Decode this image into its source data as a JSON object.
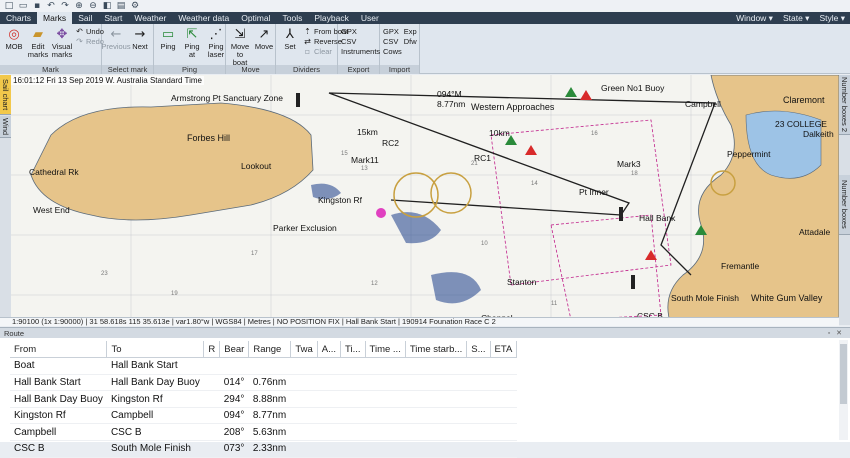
{
  "qat_icons": [
    "new-icon",
    "open-icon",
    "save-icon",
    "undo-icon",
    "redo-icon",
    "zoom-in-icon",
    "zoom-out-icon",
    "chart-icon",
    "print-icon",
    "settings-icon"
  ],
  "tabs": [
    "Charts",
    "Marks",
    "Sail",
    "Start",
    "Weather",
    "Weather data",
    "Optimal",
    "Tools",
    "Playback",
    "User"
  ],
  "active_tab": "Marks",
  "window_menus": [
    "Window",
    "State",
    "Style"
  ],
  "ribbon": {
    "mark": {
      "label": "Mark",
      "mob": "MOB",
      "edit": "Edit marks",
      "visual": "Visual marks",
      "undo": "Undo",
      "redo": "Redo"
    },
    "select_mark": {
      "label": "Select mark",
      "previous": "Previous",
      "next": "Next"
    },
    "ping": {
      "label": "Ping",
      "ping": "Ping",
      "ping_at": "Ping at",
      "ping_laser": "Ping laser"
    },
    "move": {
      "label": "Move",
      "move_to_boat": "Move to boat",
      "move": "Move"
    },
    "dividers": {
      "label": "Dividers",
      "set": "Set",
      "from_boat": "From boat",
      "reverse": "Reverse",
      "clear": "Clear"
    },
    "export": {
      "label": "Export",
      "gpx": "GPX",
      "csv": "CSV",
      "instruments": "Instruments"
    },
    "import": {
      "label": "Import",
      "gpx": "GPX",
      "csv": "CSV",
      "cows": "Cows",
      "exp": "Exp",
      "dfw": "Dfw"
    }
  },
  "side_tabs_left": [
    "Sail chart",
    "Wind"
  ],
  "side_tabs_right": [
    "Number boxes 2",
    "Number boxes"
  ],
  "chart_datetime": "16:01:12 Fri 13 Sep 2019 W. Australia Standard Time",
  "map_labels": {
    "armstrong": "Armstrong Pt Sanctuary Zone",
    "forbes": "Forbes Hill",
    "western_approaches": "Western Approaches",
    "rc2": "RC2",
    "rc1": "RC1",
    "green_no1": "Green No1 Buoy",
    "campbell": "Campbell",
    "claremont": "Claremont",
    "college": "23 COLLEGE",
    "dalkeith": "Dalkeith",
    "peppermint": "Peppermint",
    "attadale": "Attadale",
    "fremantle": "Fremantle",
    "white_gum": "White Gum Valley",
    "hall_bank": "Hall Bank",
    "stanton": "Stanton",
    "south_mole": "South Mole Finish",
    "csc_b": "CSC B",
    "channel": "Channel",
    "west_end": "West End",
    "cathedral": "Cathedral Rk",
    "parker": "Parker Exclusion",
    "lookout": "Lookout",
    "kingston": "Kingston Rf",
    "pt_inner": "Pt Inner",
    "mark3": "Mark3",
    "mark11": "Mark11",
    "dist_15km": "15km",
    "dist_10km": "10km",
    "dist_094": "094°M",
    "dist_877": "8.77nm"
  },
  "status_bar": "1:90100 (1x 1:90000) | 31 58.618s 115 35.613e | var1.80°w | WGS84 | Metres | NO POSITION FIX | Hall Bank Start | 190914 Founation Race C 2",
  "route_panel_title": "Route",
  "route_columns": [
    "From",
    "To",
    "R",
    "Bear",
    "Range",
    "Twa",
    "A...",
    "Ti...",
    "Time ...",
    "Time starb...",
    "S...",
    "ETA"
  ],
  "route_rows": [
    {
      "from": "Boat",
      "to": "Hall Bank Start",
      "r": "",
      "bear": "",
      "range": ""
    },
    {
      "from": "Hall Bank Start",
      "to": "Hall Bank Day Buoy",
      "r": "",
      "bear": "014°",
      "range": "0.76nm"
    },
    {
      "from": "Hall Bank Day Buoy",
      "to": "Kingston Rf",
      "r": "",
      "bear": "294°",
      "range": "8.88nm"
    },
    {
      "from": "Kingston Rf",
      "to": "Campbell",
      "r": "",
      "bear": "094°",
      "range": "8.77nm"
    },
    {
      "from": "Campbell",
      "to": "CSC B",
      "r": "",
      "bear": "208°",
      "range": "5.63nm"
    },
    {
      "from": "CSC B",
      "to": "South Mole Finish",
      "r": "",
      "bear": "073°",
      "range": "2.33nm"
    }
  ],
  "colors": {
    "land": "#e6c48a",
    "water": "#f4f4f0",
    "ribbon_dark": "#2e3e50",
    "route_line": "#202020",
    "magenta": "#c0208a",
    "accent_tab": "#f2c84b"
  }
}
